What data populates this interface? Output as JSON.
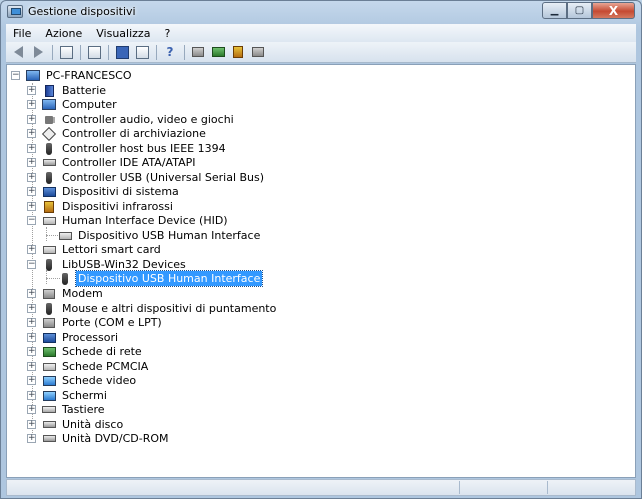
{
  "window": {
    "title": "Gestione dispositivi",
    "min_icon": "minimize-icon",
    "max_icon": "maximize-icon",
    "close_label": "X"
  },
  "menu": {
    "file": "File",
    "azione": "Azione",
    "visualizza": "Visualizza",
    "help": "?"
  },
  "toolbar": {
    "help_label": "?",
    "icons": [
      "back-arrow-icon",
      "forward-arrow-icon",
      "properties-icon",
      "view-icon",
      "help-icon",
      "help-topic-icon",
      "scan-icon",
      "update-driver-icon",
      "uninstall-icon",
      "disable-icon"
    ]
  },
  "tree": {
    "root": "PC-FRANCESCO",
    "items": [
      {
        "label": "Batterie",
        "icon": "battery-icon"
      },
      {
        "label": "Computer",
        "icon": "computer-icon"
      },
      {
        "label": "Controller audio, video e giochi",
        "icon": "speaker-icon"
      },
      {
        "label": "Controller di archiviazione",
        "icon": "storage-controller-icon"
      },
      {
        "label": "Controller host bus IEEE 1394",
        "icon": "firewire-icon"
      },
      {
        "label": "Controller IDE ATA/ATAPI",
        "icon": "ide-icon"
      },
      {
        "label": "Controller USB (Universal Serial Bus)",
        "icon": "usb-icon"
      },
      {
        "label": "Dispositivi di sistema",
        "icon": "system-device-icon"
      },
      {
        "label": "Dispositivi infrarossi",
        "icon": "infrared-icon"
      },
      {
        "label": "Human Interface Device (HID)",
        "icon": "hid-icon"
      },
      {
        "label": "Dispositivo USB Human Interface",
        "icon": "hid-device-icon"
      },
      {
        "label": "Lettori smart card",
        "icon": "smart-card-icon"
      },
      {
        "label": "LibUSB-Win32 Devices",
        "icon": "libusb-icon"
      },
      {
        "label": "Dispositivo USB Human Interface",
        "icon": "usb-device-icon"
      },
      {
        "label": "Modem",
        "icon": "modem-icon"
      },
      {
        "label": "Mouse e altri dispositivi di puntamento",
        "icon": "mouse-icon"
      },
      {
        "label": "Porte (COM e LPT)",
        "icon": "port-icon"
      },
      {
        "label": "Processori",
        "icon": "processor-icon"
      },
      {
        "label": "Schede di rete",
        "icon": "network-card-icon"
      },
      {
        "label": "Schede PCMCIA",
        "icon": "pcmcia-icon"
      },
      {
        "label": "Schede video",
        "icon": "video-card-icon"
      },
      {
        "label": "Schermi",
        "icon": "monitor-icon"
      },
      {
        "label": "Tastiere",
        "icon": "keyboard-icon"
      },
      {
        "label": "Unità disco",
        "icon": "disk-drive-icon"
      },
      {
        "label": "Unità DVD/CD-ROM",
        "icon": "dvd-drive-icon"
      }
    ]
  },
  "colors": {
    "selection": "#3399ff",
    "close_button": "#c54a32"
  }
}
